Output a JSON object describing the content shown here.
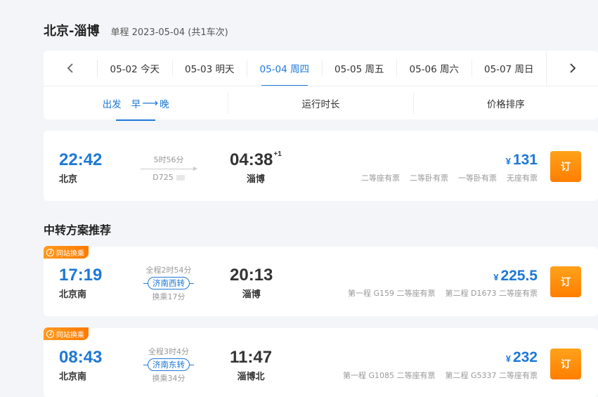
{
  "header": {
    "route": "北京-淄博",
    "subinfo": "单程 2023-05-04 (共1车次)"
  },
  "datebar": {
    "prev_icon": "chevron-left-icon",
    "next_icon": "chevron-right-icon",
    "dates": [
      {
        "label": "05-02 今天",
        "active": false
      },
      {
        "label": "05-03 明天",
        "active": false
      },
      {
        "label": "05-04 周四",
        "active": true
      },
      {
        "label": "05-05 周五",
        "active": false
      },
      {
        "label": "05-06 周六",
        "active": false
      },
      {
        "label": "05-07 周日",
        "active": false
      }
    ]
  },
  "sortbar": {
    "depart_label": "出发",
    "depart_order_from": "早",
    "depart_arrow": "⟶",
    "depart_order_to": "晚",
    "duration_label": "运行时长",
    "price_label": "价格排序"
  },
  "direct": {
    "dep_time": "22:42",
    "dep_station": "北京",
    "duration": "5时56分",
    "train_no": "D725",
    "arr_time": "04:38",
    "arr_day": "+1",
    "arr_station": "淄博",
    "seats": [
      "二等座有票",
      "二等卧有票",
      "一等卧有票",
      "无座有票"
    ],
    "currency": "¥",
    "price": "131",
    "book_label": "订"
  },
  "transfer_section_title": "中转方案推荐",
  "transfers": [
    {
      "tag": "同站换乘",
      "dep_time": "17:19",
      "dep_station": "北京南",
      "total": "全程2时54分",
      "via": "济南西转",
      "wait": "换乘17分",
      "arr_time": "20:13",
      "arr_station": "淄博",
      "currency": "¥",
      "price": "225.5",
      "leg1": "第一程 G159 二等座有票",
      "leg2": "第二程 D1673 二等座有票",
      "book_label": "订"
    },
    {
      "tag": "同站换乘",
      "dep_time": "08:43",
      "dep_station": "北京南",
      "total": "全程3时4分",
      "via": "济南东转",
      "wait": "换乘34分",
      "arr_time": "11:47",
      "arr_station": "淄博北",
      "currency": "¥",
      "price": "232",
      "leg1": "第一程 G1085 二等座有票",
      "leg2": "第二程 G5337 二等座有票",
      "book_label": "订"
    }
  ]
}
